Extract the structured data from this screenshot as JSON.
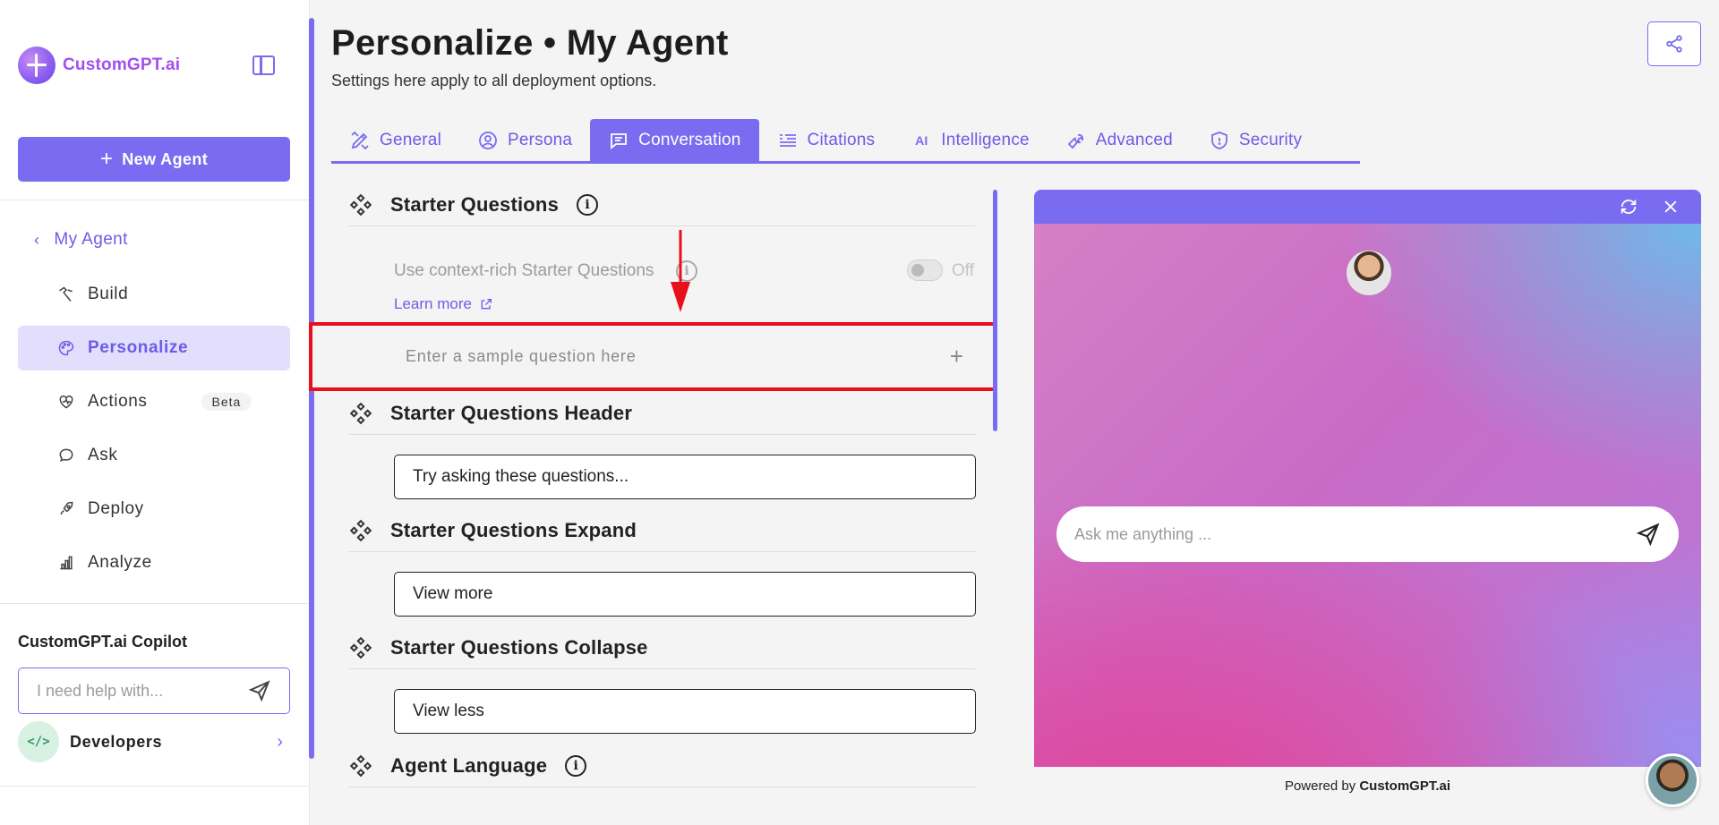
{
  "app": {
    "brand_name": "CustomGPT.ai",
    "accent_color": "#7a6cf0",
    "highlight_color": "#e8101b"
  },
  "sidebar": {
    "new_agent_label": "New Agent",
    "back_label": "My Agent",
    "items": [
      {
        "label": "Build",
        "icon": "build-icon"
      },
      {
        "label": "Personalize",
        "icon": "palette-icon",
        "active": true
      },
      {
        "label": "Actions",
        "icon": "actions-icon",
        "badge": "Beta"
      },
      {
        "label": "Ask",
        "icon": "chat-icon"
      },
      {
        "label": "Deploy",
        "icon": "rocket-icon"
      },
      {
        "label": "Analyze",
        "icon": "bar-chart-icon"
      }
    ],
    "copilot_title": "CustomGPT.ai Copilot",
    "copilot_placeholder": "I need help with...",
    "developers_label": "Developers"
  },
  "header": {
    "title": "Personalize • My Agent",
    "subtitle": "Settings here apply to all deployment options."
  },
  "tabs": [
    {
      "label": "General",
      "icon": "pencil-ruler-icon"
    },
    {
      "label": "Persona",
      "icon": "user-circle-icon"
    },
    {
      "label": "Conversation",
      "icon": "message-icon",
      "active": true
    },
    {
      "label": "Citations",
      "icon": "quote-icon"
    },
    {
      "label": "Intelligence",
      "icon": "ai-icon"
    },
    {
      "label": "Advanced",
      "icon": "wrench-icon"
    },
    {
      "label": "Security",
      "icon": "shield-icon"
    }
  ],
  "settings": {
    "starter_questions": {
      "title": "Starter Questions",
      "context_label": "Use context-rich Starter Questions",
      "toggle_state": "Off",
      "learn_more": "Learn more",
      "sample_placeholder": "Enter a sample question here"
    },
    "starter_header": {
      "title": "Starter Questions Header",
      "value": "Try asking these questions..."
    },
    "starter_expand": {
      "title": "Starter Questions Expand",
      "value": "View more"
    },
    "starter_collapse": {
      "title": "Starter Questions Collapse",
      "value": "View less"
    },
    "agent_language": {
      "title": "Agent Language"
    }
  },
  "preview": {
    "chat_placeholder": "Ask me anything ...",
    "powered_prefix": "Powered by",
    "powered_brand": "CustomGPT.ai"
  }
}
